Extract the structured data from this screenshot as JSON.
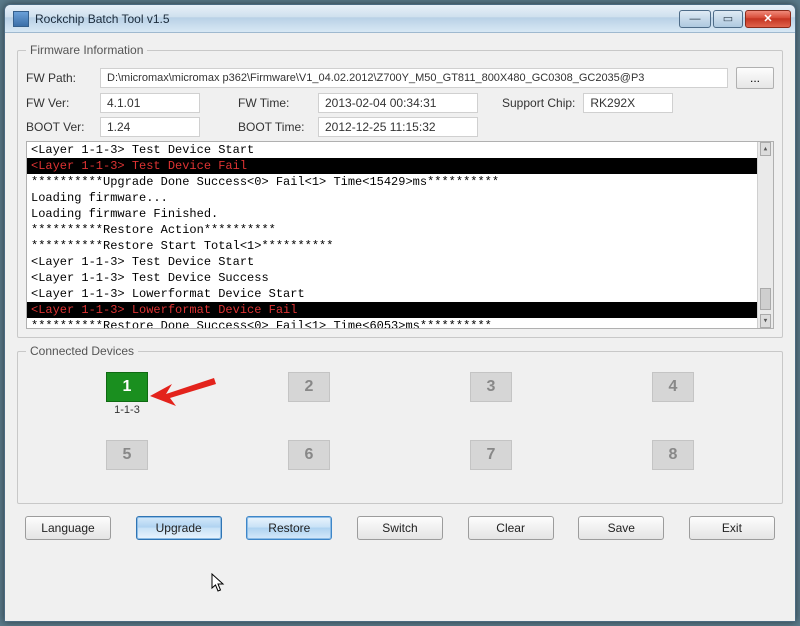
{
  "window": {
    "title": "Rockchip Batch Tool v1.5"
  },
  "firmware": {
    "legend": "Firmware Information",
    "fw_path_label": "FW Path:",
    "fw_path": "D:\\micromax\\micromax p362\\Firmware\\V1_04.02.2012\\Z700Y_M50_GT811_800X480_GC0308_GC2035@P3",
    "fw_ver_label": "FW Ver:",
    "fw_ver": "4.1.01",
    "fw_time_label": "FW Time:",
    "fw_time": "2013-02-04 00:34:31",
    "support_chip_label": "Support Chip:",
    "support_chip": "RK292X",
    "boot_ver_label": "BOOT Ver:",
    "boot_ver": "1.24",
    "boot_time_label": "BOOT Time:",
    "boot_time": "2012-12-25 11:15:32",
    "browse_label": "..."
  },
  "log": [
    {
      "text": "<Layer 1-1-3> Test Device Start",
      "err": false
    },
    {
      "text": "<Layer 1-1-3> Test Device Fail",
      "err": true
    },
    {
      "text": "**********Upgrade Done Success<0> Fail<1> Time<15429>ms**********",
      "err": false
    },
    {
      "text": "Loading firmware...",
      "err": false
    },
    {
      "text": "Loading firmware Finished.",
      "err": false
    },
    {
      "text": "**********Restore Action**********",
      "err": false
    },
    {
      "text": "**********Restore Start Total<1>**********",
      "err": false
    },
    {
      "text": "<Layer 1-1-3> Test Device Start",
      "err": false
    },
    {
      "text": "<Layer 1-1-3> Test Device Success",
      "err": false
    },
    {
      "text": "<Layer 1-1-3> Lowerformat Device Start",
      "err": false
    },
    {
      "text": "<Layer 1-1-3> Lowerformat Device Fail",
      "err": true
    },
    {
      "text": "**********Restore Done Success<0> Fail<1> Time<6053>ms**********",
      "err": false
    }
  ],
  "devices": {
    "legend": "Connected Devices",
    "slots": [
      {
        "num": "1",
        "active": true,
        "label": "1-1-3"
      },
      {
        "num": "2",
        "active": false,
        "label": ""
      },
      {
        "num": "3",
        "active": false,
        "label": ""
      },
      {
        "num": "4",
        "active": false,
        "label": ""
      },
      {
        "num": "5",
        "active": false,
        "label": ""
      },
      {
        "num": "6",
        "active": false,
        "label": ""
      },
      {
        "num": "7",
        "active": false,
        "label": ""
      },
      {
        "num": "8",
        "active": false,
        "label": ""
      }
    ]
  },
  "buttons": {
    "language": "Language",
    "upgrade": "Upgrade",
    "restore": "Restore",
    "switch": "Switch",
    "clear": "Clear",
    "save": "Save",
    "exit": "Exit"
  }
}
